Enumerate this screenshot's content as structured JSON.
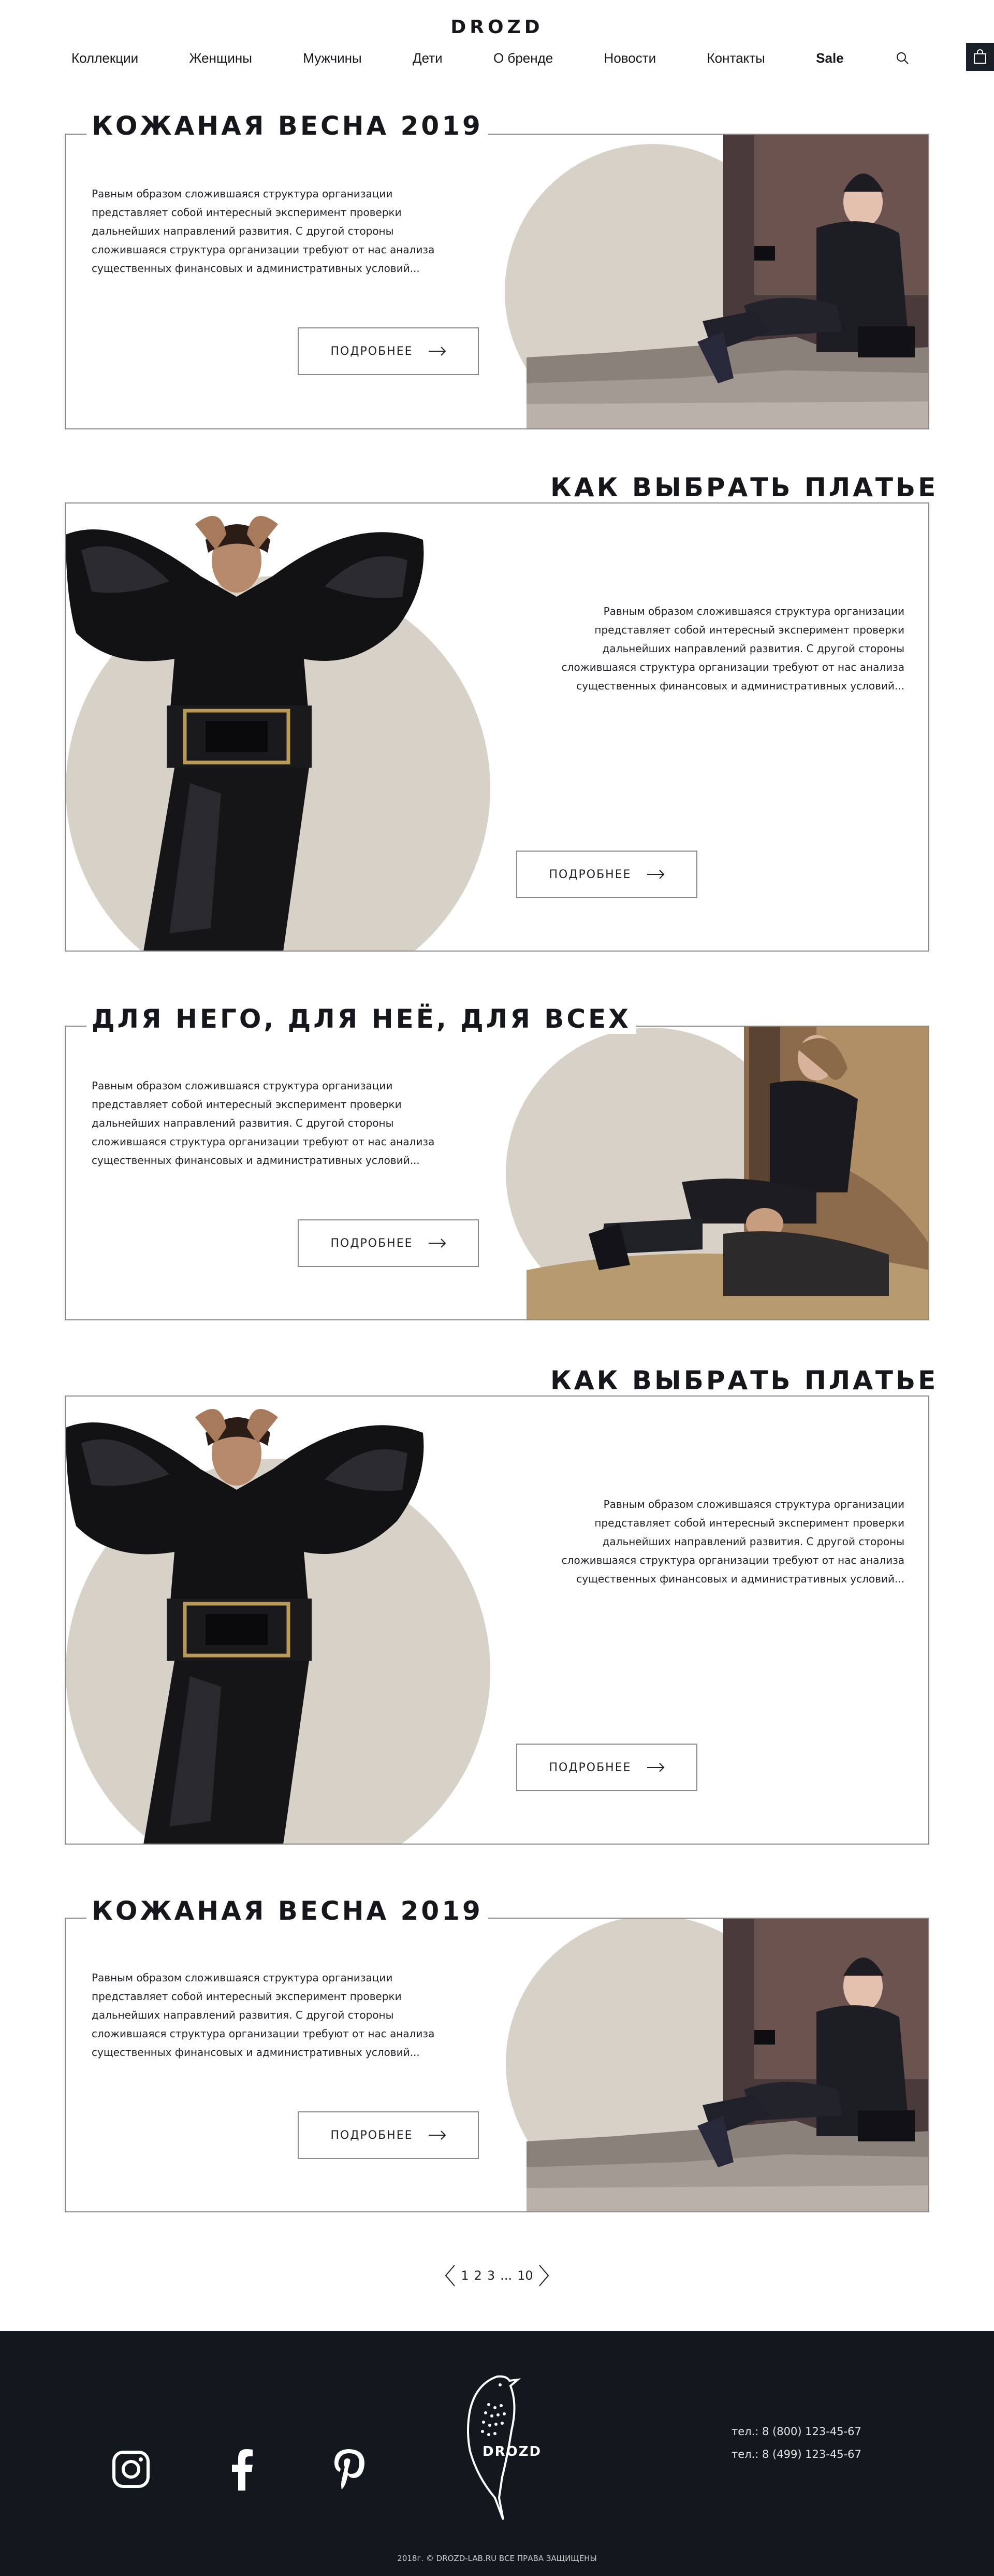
{
  "header": {
    "logo": "DROZD",
    "nav": [
      "Коллекции",
      "Женщины",
      "Мужчины",
      "Дети",
      "О бренде",
      "Новости",
      "Контакты",
      "Sale"
    ]
  },
  "articles": [
    {
      "title": "КОЖАНАЯ ВЕСНА 2019",
      "text": "Равным образом сложившаяся структура организации представляет собой интересный эксперимент проверки дальнейших направлений развития. С другой стороны сложившаяся структура организации требуют от нас анализа существенных финансовых и административных условий...",
      "button": "ПОДРОБНЕЕ"
    },
    {
      "title": "КАК ВЫБРАТЬ ПЛАТЬЕ",
      "text": "Равным образом сложившаяся структура организации представляет собой интересный эксперимент проверки дальнейших направлений развития. С другой стороны сложившаяся структура организации требуют от нас анализа существенных финансовых и административных условий...",
      "button": "ПОДРОБНЕЕ"
    },
    {
      "title": "ДЛЯ НЕГО, ДЛЯ НЕЁ, ДЛЯ ВСЕХ",
      "text": "Равным образом сложившаяся структура организации представляет собой интересный эксперимент проверки дальнейших направлений развития. С другой стороны сложившаяся структура организации требуют от нас анализа существенных финансовых и административных условий...",
      "button": "ПОДРОБНЕЕ"
    },
    {
      "title": "КАК ВЫБРАТЬ ПЛАТЬЕ",
      "text": "Равным образом сложившаяся структура организации представляет собой интересный эксперимент проверки дальнейших направлений развития. С другой стороны сложившаяся структура организации требуют от нас анализа существенных финансовых и административных условий...",
      "button": "ПОДРОБНЕЕ"
    },
    {
      "title": "КОЖАНАЯ ВЕСНА 2019",
      "text": "Равным образом сложившаяся структура организации представляет собой интересный эксперимент проверки дальнейших направлений развития. С другой стороны сложившаяся структура организации требуют от нас анализа существенных финансовых и административных условий...",
      "button": "ПОДРОБНЕЕ"
    }
  ],
  "pagination": {
    "pages": [
      "1",
      "2",
      "3"
    ],
    "ellipsis": "...",
    "last": "10"
  },
  "footer": {
    "logo": "DROZD",
    "phones": [
      "тел.: 8 (800) 123-45-67",
      "тел.: 8 (499) 123-45-67"
    ],
    "copyright": "2018г. © DROZD-LAB.RU ВСЕ ПРАВА ЗАЩИЩЕНЫ"
  },
  "colors": {
    "accent_circle": "#d8d1c8",
    "footer_bg": "#13171e",
    "border": "#8b8b8b"
  }
}
